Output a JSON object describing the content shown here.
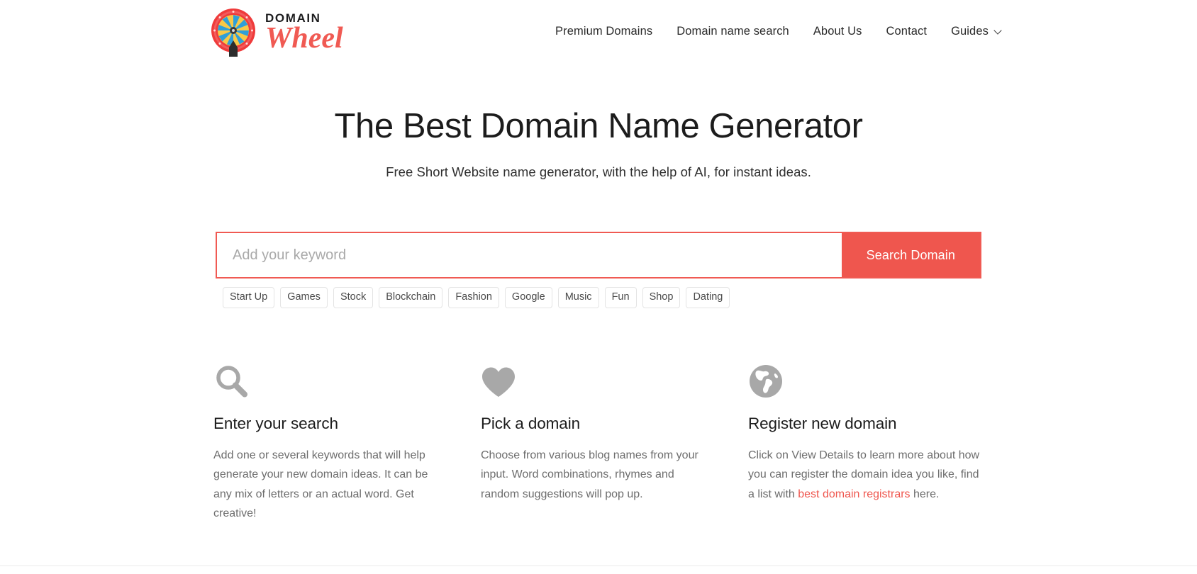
{
  "brand": {
    "line1": "DOMAIN",
    "line2": "Wheel",
    "logo_icon": "prize-wheel-icon"
  },
  "nav": {
    "items": [
      {
        "label": "Premium Domains",
        "has_dropdown": false
      },
      {
        "label": "Domain name search",
        "has_dropdown": false
      },
      {
        "label": "About Us",
        "has_dropdown": false
      },
      {
        "label": "Contact",
        "has_dropdown": false
      },
      {
        "label": "Guides",
        "has_dropdown": true
      }
    ]
  },
  "hero": {
    "title": "The Best Domain Name Generator",
    "subtitle": "Free Short Website name generator, with the help of AI, for instant ideas."
  },
  "search": {
    "placeholder": "Add your keyword",
    "value": "",
    "button_label": "Search Domain",
    "accent_color": "#ef564e",
    "chips": [
      "Start Up",
      "Games",
      "Stock",
      "Blockchain",
      "Fashion",
      "Google",
      "Music",
      "Fun",
      "Shop",
      "Dating"
    ]
  },
  "features": [
    {
      "icon": "magnifier-icon",
      "title": "Enter your search",
      "text": "Add one or several keywords that will help generate your new domain ideas. It can be any mix of letters or an actual word. Get creative!"
    },
    {
      "icon": "heart-icon",
      "title": "Pick a domain",
      "text": "Choose from various blog names from your input. Word combinations, rhymes and random suggestions will pop up."
    },
    {
      "icon": "globe-icon",
      "title": "Register new domain",
      "text_before_link": "Click on View Details to learn more about how you can register the domain idea you like, find a list with ",
      "link_label": "best domain registrars",
      "text_after_link": " here."
    }
  ],
  "colors": {
    "accent": "#ef564e",
    "logo_red": "#f05a53",
    "icon_gray": "#a8a8a8",
    "body_text": "#6d6d6d",
    "heading": "#1c1c1c"
  }
}
